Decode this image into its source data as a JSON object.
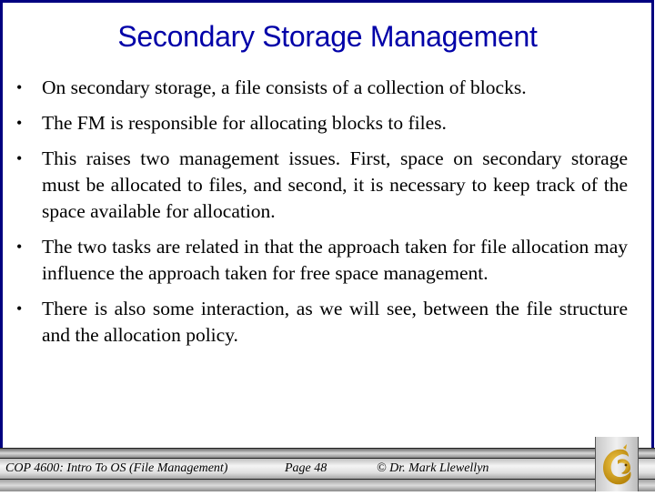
{
  "slide": {
    "title": "Secondary Storage Management",
    "bullets": [
      "On secondary storage, a file consists of a collection of blocks.",
      "The FM is responsible for allocating blocks to files.",
      "This raises two management issues.  First, space on secondary storage must be allocated to files, and second, it is necessary to keep track of the space available for allocation.",
      "The two tasks are related in that the approach taken for file allocation may influence the approach taken for free space management.",
      "There is also some interaction, as we will see, between the file structure and the allocation policy."
    ],
    "bullet_symbol": "•"
  },
  "footer": {
    "course": "COP 4600: Intro To OS  (File Management)",
    "page": "Page 48",
    "author": "© Dr. Mark Llewellyn",
    "logo": "ucf-pegasus-logo"
  },
  "colors": {
    "border": "#000080",
    "title": "#0000a8",
    "logo_gold": "#d4a017"
  }
}
